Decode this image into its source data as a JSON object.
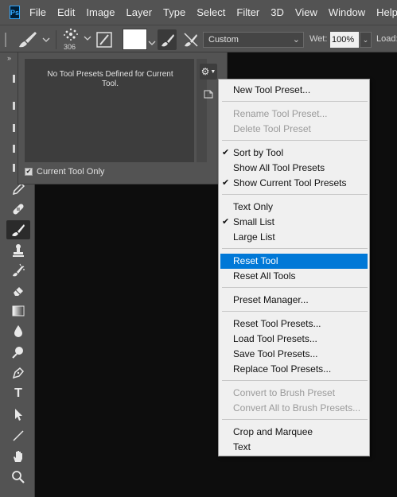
{
  "app": {
    "logo_text": "Ps"
  },
  "menubar": {
    "items": [
      "File",
      "Edit",
      "Image",
      "Layer",
      "Type",
      "Select",
      "Filter",
      "3D",
      "View",
      "Window",
      "Help"
    ]
  },
  "options_bar": {
    "brush_size": "306",
    "mode_value": "Custom",
    "wet_label": "Wet:",
    "wet_value": "100%",
    "load_label": "Load:"
  },
  "toolbar": {
    "tools": [
      "pencil-tool",
      "healing-brush-tool",
      "brush-tool",
      "clone-stamp-tool",
      "history-brush-tool",
      "eraser-tool",
      "gradient-tool",
      "blur-tool",
      "dodge-tool",
      "pen-tool",
      "type-tool",
      "path-selection-tool",
      "line-tool",
      "hand-tool",
      "zoom-tool"
    ],
    "type_glyph": "T"
  },
  "presets_panel": {
    "empty_message": "No Tool Presets Defined for Current Tool.",
    "current_tool_only_label": "Current Tool Only",
    "current_tool_only_checked": true
  },
  "flyout_menu": {
    "items": [
      {
        "label": "New Tool Preset...",
        "enabled": true,
        "checked": false
      },
      {
        "label": "Rename Tool Preset...",
        "enabled": false,
        "checked": false
      },
      {
        "label": "Delete Tool Preset",
        "enabled": false,
        "checked": false
      },
      {
        "label": "Sort by Tool",
        "enabled": true,
        "checked": true
      },
      {
        "label": "Show All Tool Presets",
        "enabled": true,
        "checked": false
      },
      {
        "label": "Show Current Tool Presets",
        "enabled": true,
        "checked": true
      },
      {
        "label": "Text Only",
        "enabled": true,
        "checked": false
      },
      {
        "label": "Small List",
        "enabled": true,
        "checked": true
      },
      {
        "label": "Large List",
        "enabled": true,
        "checked": false
      },
      {
        "label": "Reset Tool",
        "enabled": true,
        "checked": false,
        "highlighted": true
      },
      {
        "label": "Reset All Tools",
        "enabled": true,
        "checked": false
      },
      {
        "label": "Preset Manager...",
        "enabled": true,
        "checked": false
      },
      {
        "label": "Reset Tool Presets...",
        "enabled": true,
        "checked": false
      },
      {
        "label": "Load Tool Presets...",
        "enabled": true,
        "checked": false
      },
      {
        "label": "Save Tool Presets...",
        "enabled": true,
        "checked": false
      },
      {
        "label": "Replace Tool Presets...",
        "enabled": true,
        "checked": false
      },
      {
        "label": "Convert to Brush Preset",
        "enabled": false,
        "checked": false
      },
      {
        "label": "Convert All to Brush Presets...",
        "enabled": false,
        "checked": false
      },
      {
        "label": "Crop and Marquee",
        "enabled": true,
        "checked": false
      },
      {
        "label": "Text",
        "enabled": true,
        "checked": false
      }
    ],
    "highlight_color": "#0078d7"
  },
  "colors": {
    "chrome": "#535353",
    "canvas": "#0d0d0d",
    "accent": "#31a8ff"
  }
}
